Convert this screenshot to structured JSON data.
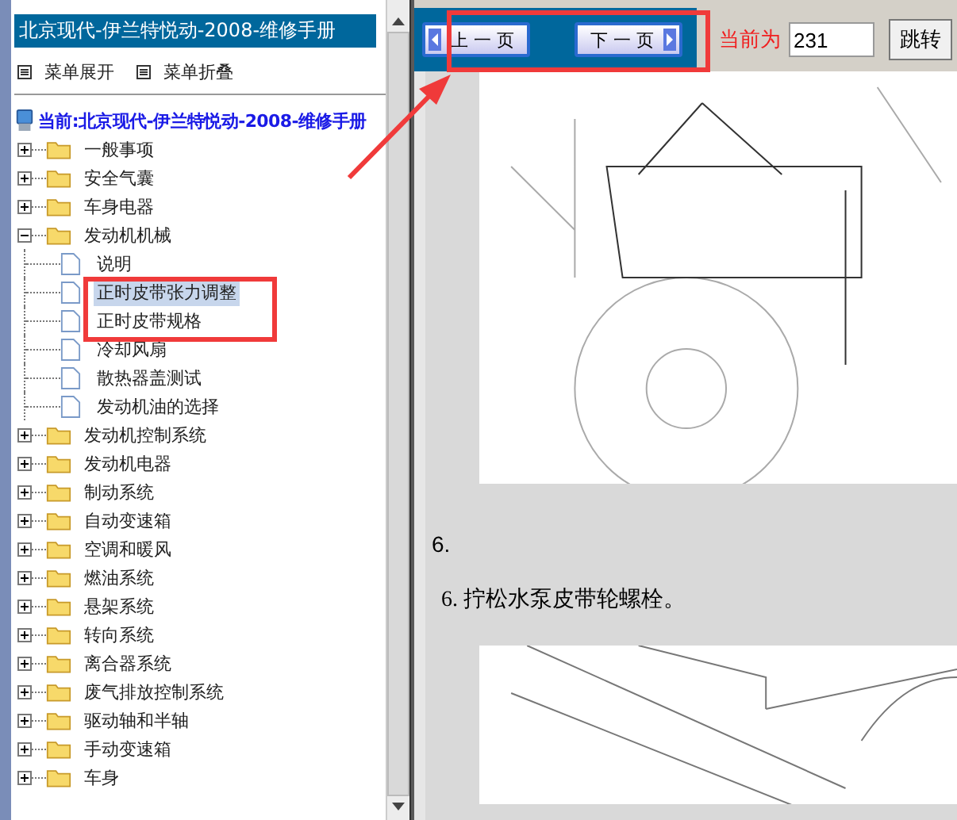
{
  "sidebar": {
    "title": "北京现代-伊兰特悦动-2008-维修手册",
    "actions": [
      {
        "label": "菜单展开"
      },
      {
        "label": "菜单折叠"
      }
    ],
    "tree": {
      "root": "当前:北京现代-伊兰特悦动-2008-维修手册",
      "items": [
        {
          "label": "一般事项",
          "expanded": false
        },
        {
          "label": "安全气囊",
          "expanded": false
        },
        {
          "label": "车身电器",
          "expanded": false
        },
        {
          "label": "发动机机械",
          "expanded": true,
          "children": [
            {
              "label": "说明",
              "selected": false
            },
            {
              "label": "正时皮带张力调整",
              "selected": true
            },
            {
              "label": "正时皮带规格",
              "selected": false
            },
            {
              "label": "冷却风扇",
              "selected": false
            },
            {
              "label": "散热器盖测试",
              "selected": false
            },
            {
              "label": "发动机油的选择",
              "selected": false
            }
          ]
        },
        {
          "label": "发动机控制系统",
          "expanded": false
        },
        {
          "label": "发动机电器",
          "expanded": false
        },
        {
          "label": "制动系统",
          "expanded": false
        },
        {
          "label": "自动变速箱",
          "expanded": false
        },
        {
          "label": "空调和暖风",
          "expanded": false
        },
        {
          "label": "燃油系统",
          "expanded": false
        },
        {
          "label": "悬架系统",
          "expanded": false
        },
        {
          "label": "转向系统",
          "expanded": false
        },
        {
          "label": "离合器系统",
          "expanded": false
        },
        {
          "label": "废气排放控制系统",
          "expanded": false
        },
        {
          "label": "驱动轴和半轴",
          "expanded": false
        },
        {
          "label": "手动变速箱",
          "expanded": false
        },
        {
          "label": "车身",
          "expanded": false
        }
      ]
    }
  },
  "toolbar": {
    "prev_button": "上 一 页",
    "next_button": "下 一 页",
    "current_label": "当前为",
    "page_value": "231",
    "jump_button": "跳转"
  },
  "content": {
    "step_number": "6.",
    "step_text": "6. 拧松水泵皮带轮螺栓。"
  }
}
